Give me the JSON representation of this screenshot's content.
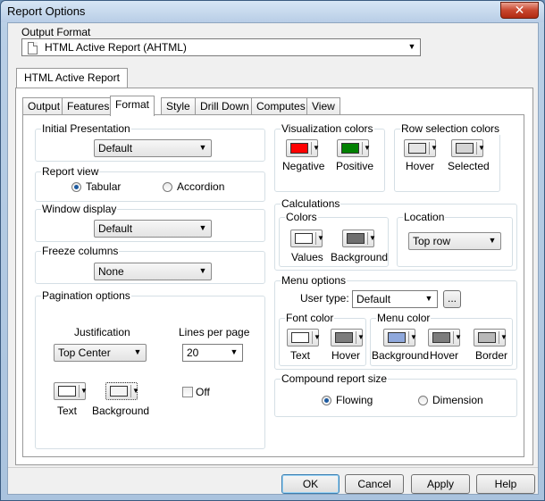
{
  "window": {
    "title": "Report Options",
    "close_glyph": "✕"
  },
  "output_format": {
    "label": "Output Format",
    "value": "HTML Active Report (AHTML)",
    "icon": "document-icon"
  },
  "outer_tab": {
    "label": "HTML Active Report"
  },
  "tabs": [
    {
      "label": "Output"
    },
    {
      "label": "Features"
    },
    {
      "label": "Format"
    },
    {
      "label": "Style"
    },
    {
      "label": "Drill Down"
    },
    {
      "label": "Computes"
    },
    {
      "label": "View"
    }
  ],
  "active_tab": "Format",
  "initial_presentation": {
    "title": "Initial Presentation",
    "value": "Default"
  },
  "report_view": {
    "title": "Report view",
    "options": [
      "Tabular",
      "Accordion"
    ],
    "selected": "Tabular"
  },
  "window_display": {
    "title": "Window display",
    "value": "Default"
  },
  "freeze_columns": {
    "title": "Freeze columns",
    "value": "None"
  },
  "pagination": {
    "title": "Pagination options",
    "justification_label": "Justification",
    "justification_value": "Top Center",
    "lines_label": "Lines per page",
    "lines_value": "20",
    "text_label": "Text",
    "background_label": "Background",
    "off_label": "Off",
    "off_checked": false
  },
  "visualization_colors": {
    "title": "Visualization colors",
    "negative_label": "Negative",
    "positive_label": "Positive",
    "negative_color": "#ff0000",
    "positive_color": "#008000"
  },
  "row_selection_colors": {
    "title": "Row selection colors",
    "hover_label": "Hover",
    "selected_label": "Selected",
    "hover_color": "#e4e4e4",
    "selected_color": "#d4d4d4"
  },
  "calculations": {
    "title": "Calculations",
    "colors_title": "Colors",
    "values_label": "Values",
    "background_label": "Background",
    "values_color": "#ffffff",
    "background_color": "#6f6f6f",
    "location_title": "Location",
    "location_value": "Top row"
  },
  "menu_options": {
    "title": "Menu options",
    "user_type_label": "User type:",
    "user_type_value": "Default",
    "ellipsis": "...",
    "font_color_title": "Font color",
    "font_text_label": "Text",
    "font_hover_label": "Hover",
    "font_text_color": "#ffffff",
    "font_hover_color": "#7c7c7c",
    "menu_color_title": "Menu color",
    "menu_background_label": "Background",
    "menu_hover_label": "Hover",
    "menu_border_label": "Border",
    "menu_background_color": "#8fa8dc",
    "menu_hover_color": "#7c7c7c",
    "menu_border_color": "#b8b8b8"
  },
  "compound_report_size": {
    "title": "Compound report size",
    "options": [
      "Flowing",
      "Dimension"
    ],
    "selected": "Flowing"
  },
  "buttons": {
    "ok": "OK",
    "cancel": "Cancel",
    "apply": "Apply",
    "help": "Help"
  }
}
